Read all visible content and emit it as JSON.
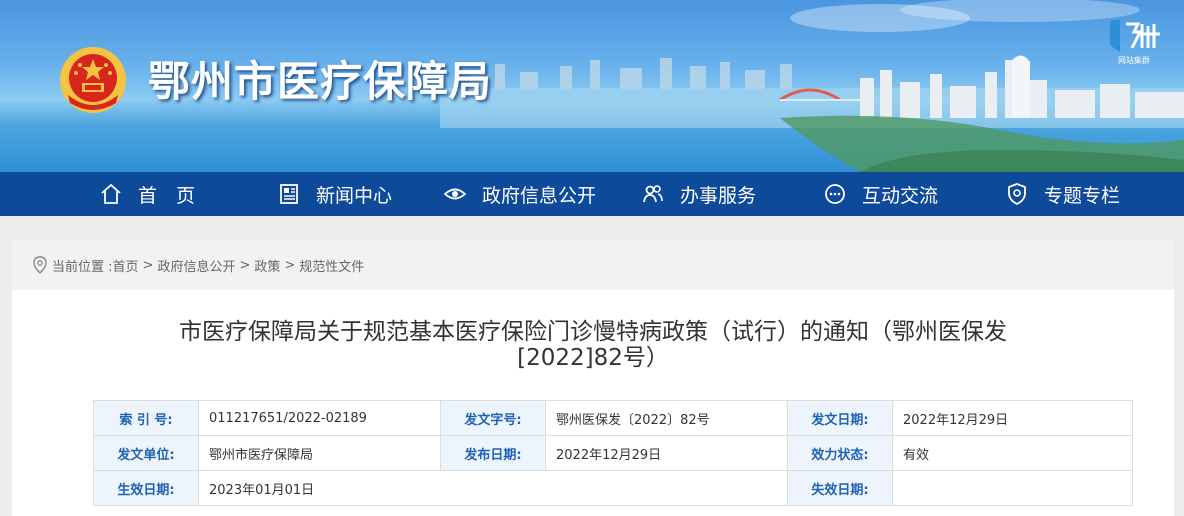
{
  "site": {
    "title": "鄂州市医疗保障局",
    "logo_sub": "网站集群"
  },
  "nav": {
    "items": [
      {
        "label": "首　页",
        "icon": "home-icon"
      },
      {
        "label": "新闻中心",
        "icon": "newspaper-icon"
      },
      {
        "label": "政府信息公开",
        "icon": "eye-icon"
      },
      {
        "label": "办事服务",
        "icon": "people-icon"
      },
      {
        "label": "互动交流",
        "icon": "chat-icon"
      },
      {
        "label": "专题专栏",
        "icon": "shield-icon"
      }
    ]
  },
  "breadcrumb": {
    "prefix": "当前位置 :",
    "items": [
      "首页",
      "政府信息公开",
      "政策",
      "规范性文件"
    ],
    "separator": ">"
  },
  "document": {
    "title_line1": "市医疗保障局关于规范基本医疗保险门诊慢特病政策（试行）的通知（鄂州医保发",
    "title_line2": "[2022]82号）"
  },
  "meta": {
    "row1": {
      "k1": "索  引  号:",
      "v1": "011217651/2022-02189",
      "k2": "发文字号:",
      "v2": "鄂州医保发〔2022〕82号",
      "k3": "发文日期:",
      "v3": "2022年12月29日"
    },
    "row2": {
      "k1": "发文单位:",
      "v1": "鄂州市医疗保障局",
      "k2": "发布日期:",
      "v2": "2022年12月29日",
      "k3": "效力状态:",
      "v3": "有效"
    },
    "row3": {
      "k1": "生效日期:",
      "v1": "2023年01月01日",
      "k3": "失效日期:",
      "v3": ""
    }
  },
  "colors": {
    "nav_bg": "#0d4a9a",
    "label_blue": "#1e63b5",
    "banner_sky": "#68b1ec"
  }
}
